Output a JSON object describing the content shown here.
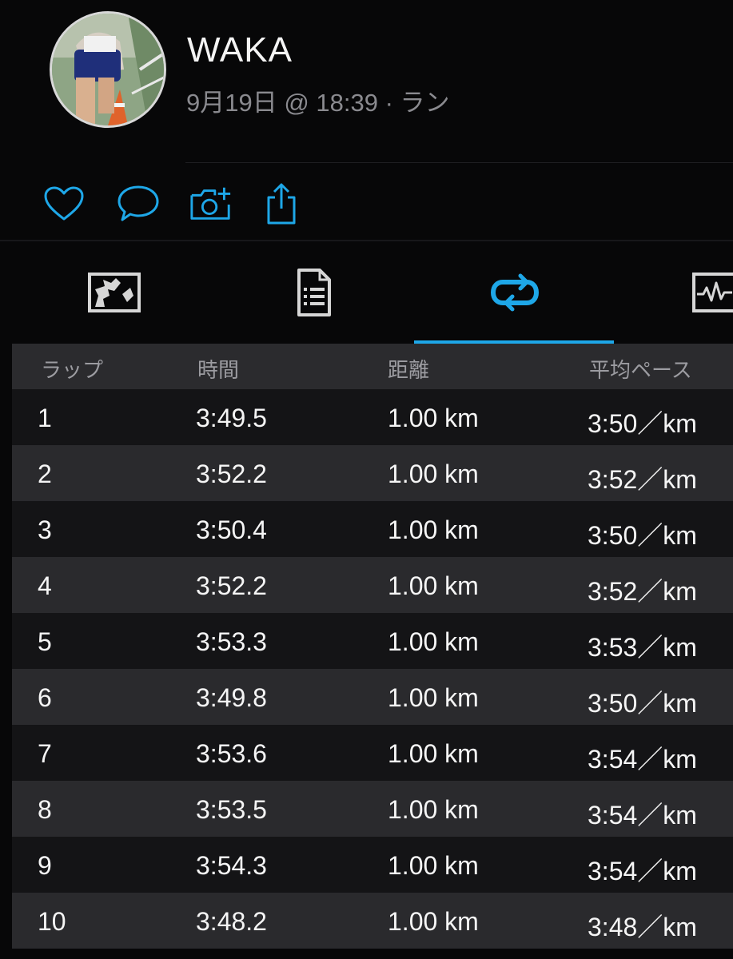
{
  "profile": {
    "name": "WAKA",
    "meta": "9月19日 @ 18:39 · ラン"
  },
  "actions": [
    {
      "icon": "heart-icon"
    },
    {
      "icon": "comment-icon"
    },
    {
      "icon": "add-photo-icon"
    },
    {
      "icon": "share-icon"
    }
  ],
  "tabs": [
    {
      "icon": "map-icon",
      "active": false
    },
    {
      "icon": "details-icon",
      "active": false
    },
    {
      "icon": "laps-icon",
      "active": true
    },
    {
      "icon": "chart-icon",
      "active": false
    }
  ],
  "colors": {
    "accent": "#1ea7e8",
    "background": "#070708",
    "row_dark": "#141416",
    "row_light": "#2a2a2d"
  },
  "laps_table": {
    "headers": {
      "lap": "ラップ",
      "time": "時間",
      "distance": "距離",
      "pace": "平均ペース"
    },
    "rows": [
      {
        "lap": "1",
        "time": "3:49.5",
        "distance": "1.00 km",
        "pace": "3:50／km"
      },
      {
        "lap": "2",
        "time": "3:52.2",
        "distance": "1.00 km",
        "pace": "3:52／km"
      },
      {
        "lap": "3",
        "time": "3:50.4",
        "distance": "1.00 km",
        "pace": "3:50／km"
      },
      {
        "lap": "4",
        "time": "3:52.2",
        "distance": "1.00 km",
        "pace": "3:52／km"
      },
      {
        "lap": "5",
        "time": "3:53.3",
        "distance": "1.00 km",
        "pace": "3:53／km"
      },
      {
        "lap": "6",
        "time": "3:49.8",
        "distance": "1.00 km",
        "pace": "3:50／km"
      },
      {
        "lap": "7",
        "time": "3:53.6",
        "distance": "1.00 km",
        "pace": "3:54／km"
      },
      {
        "lap": "8",
        "time": "3:53.5",
        "distance": "1.00 km",
        "pace": "3:54／km"
      },
      {
        "lap": "9",
        "time": "3:54.3",
        "distance": "1.00 km",
        "pace": "3:54／km"
      },
      {
        "lap": "10",
        "time": "3:48.2",
        "distance": "1.00 km",
        "pace": "3:48／km"
      }
    ]
  }
}
